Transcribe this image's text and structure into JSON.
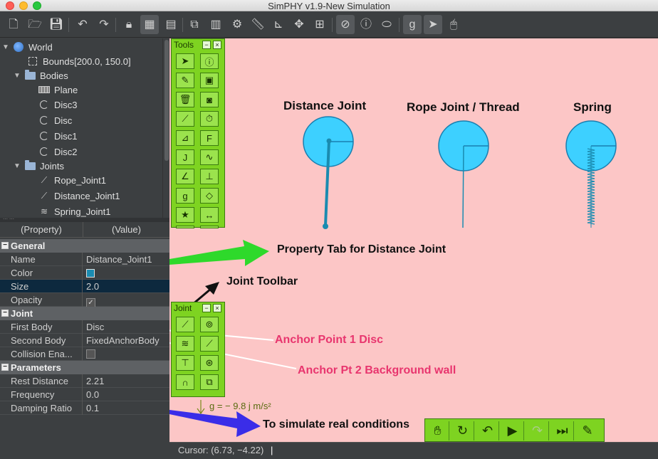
{
  "window": {
    "title": "SimPHY v1.9-New Simulation"
  },
  "toolbar": {
    "icons": [
      "new-file-icon",
      "open-folder-icon",
      "save-icon",
      "undo-icon",
      "redo-icon",
      "lock-icon",
      "table-icon",
      "table-edit-icon",
      "script-icon",
      "calculator-icon",
      "gear-icon",
      "ruler-icon",
      "axes-icon",
      "move-icon",
      "grid-icon",
      "stop-circle-icon",
      "info-circle-icon",
      "tag-icon",
      "gravity-icon",
      "pointer-icon",
      "mouse-icon"
    ]
  },
  "tree": {
    "items": [
      {
        "label": "World",
        "icon": "globe-icon",
        "depth": 0,
        "expanded": true
      },
      {
        "label": "Bounds[200.0, 150.0]",
        "icon": "bounds-icon",
        "depth": 1
      },
      {
        "label": "Bodies",
        "icon": "folder-icon",
        "depth": 1,
        "expanded": true
      },
      {
        "label": "Plane",
        "icon": "plane-icon",
        "depth": 2
      },
      {
        "label": "Disc3",
        "icon": "disc-icon",
        "depth": 2
      },
      {
        "label": "Disc",
        "icon": "disc-icon",
        "depth": 2
      },
      {
        "label": "Disc1",
        "icon": "disc-icon",
        "depth": 2
      },
      {
        "label": "Disc2",
        "icon": "disc-icon",
        "depth": 2
      },
      {
        "label": "Joints",
        "icon": "folder-icon",
        "depth": 1,
        "expanded": true
      },
      {
        "label": "Rope_Joint1",
        "icon": "rope-joint-icon",
        "depth": 2
      },
      {
        "label": "Distance_Joint1",
        "icon": "distance-joint-icon",
        "depth": 2
      },
      {
        "label": "Spring_Joint1",
        "icon": "spring-joint-icon",
        "depth": 2
      }
    ]
  },
  "properties": {
    "header_property": "(Property)",
    "header_value": "(Value)",
    "general": "General",
    "name_label": "Name",
    "name_value": "Distance_Joint1",
    "color_label": "Color",
    "color_value": "#1a8bb0",
    "size_label": "Size",
    "size_value": "2.0",
    "opacity_label": "Opacity",
    "opacity_checked": true,
    "joint": "Joint",
    "first_body_label": "First Body",
    "first_body_value": "Disc",
    "second_body_label": "Second Body",
    "second_body_value": "FixedAnchorBody",
    "collision_label": "Collision Ena...",
    "collision_checked": false,
    "parameters": "Parameters",
    "rest_distance_label": "Rest Distance",
    "rest_distance_value": "2.21",
    "frequency_label": "Frequency",
    "frequency_value": "0.0",
    "damping_label": "Damping Ratio",
    "damping_value": "0.1"
  },
  "palettes": {
    "tools_title": "Tools",
    "tools_icons": [
      "pointer-icon",
      "info-icon",
      "pen-icon",
      "mouse-icon",
      "trash-icon",
      "camera-icon",
      "graph-icon",
      "stopwatch-icon",
      "vector-icon",
      "force-icon",
      "joint-j-icon",
      "wave-icon",
      "angle-icon",
      "axes-icon",
      "gravity-icon",
      "shapes-icon",
      "star-icon",
      "distance-icon",
      "triangle-icon",
      "link-icon"
    ],
    "joint_title": "Joint",
    "joint_icons": [
      "distance-joint-icon",
      "revolute-joint-icon",
      "spring-joint-icon",
      "rope-joint-icon",
      "pulley-joint-icon",
      "wheel-joint-icon",
      "arch-joint-icon",
      "weld-joint-icon"
    ]
  },
  "canvas": {
    "background": "#fcc6c6",
    "disc_color": "#3dd0ff",
    "labels": {
      "distance_joint": "Distance Joint",
      "rope_joint": "Rope Joint / Thread",
      "spring": "Spring"
    },
    "annotations": {
      "property_tab": "Property Tab for Distance Joint",
      "joint_toolbar": "Joint Toolbar",
      "anchor1": "Anchor Point 1 Disc",
      "anchor2": "Anchor Pt 2 Background wall",
      "simulate": "To simulate real conditions"
    },
    "gravity": "g = − 9.8 j m/s²"
  },
  "sim_controls": [
    "hand-icon",
    "reset-icon",
    "undo-icon",
    "play-icon",
    "redo-icon",
    "step-icon",
    "edit-icon"
  ],
  "status": {
    "cursor": "Cursor: (6.73, −4.22)"
  }
}
